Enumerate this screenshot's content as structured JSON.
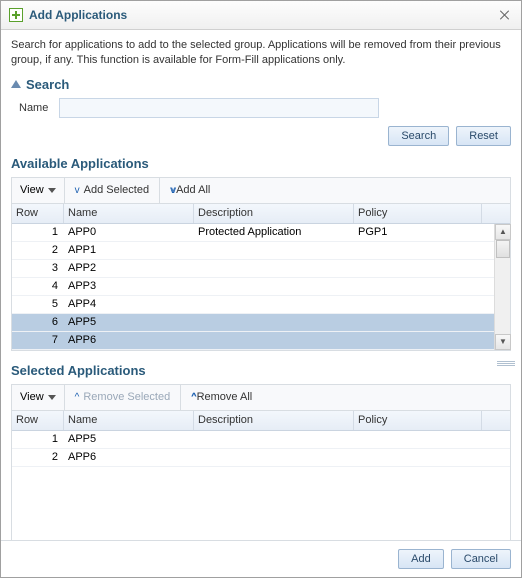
{
  "title": "Add Applications",
  "description": "Search for applications to add to the selected group. Applications will be removed from their previous group, if any. This function is available for Form-Fill applications only.",
  "search": {
    "heading": "Search",
    "name_label": "Name",
    "name_value": "",
    "search_btn": "Search",
    "reset_btn": "Reset"
  },
  "available": {
    "heading": "Available Applications",
    "view_label": "View",
    "add_selected": "Add Selected",
    "add_all": "Add All",
    "columns": {
      "row": "Row",
      "name": "Name",
      "desc": "Description",
      "policy": "Policy"
    },
    "rows": [
      {
        "n": "1",
        "name": "APP0",
        "desc": "Protected Application",
        "policy": "PGP1",
        "selected": false
      },
      {
        "n": "2",
        "name": "APP1",
        "desc": "",
        "policy": "",
        "selected": false
      },
      {
        "n": "3",
        "name": "APP2",
        "desc": "",
        "policy": "",
        "selected": false
      },
      {
        "n": "4",
        "name": "APP3",
        "desc": "",
        "policy": "",
        "selected": false
      },
      {
        "n": "5",
        "name": "APP4",
        "desc": "",
        "policy": "",
        "selected": false
      },
      {
        "n": "6",
        "name": "APP5",
        "desc": "",
        "policy": "",
        "selected": true
      },
      {
        "n": "7",
        "name": "APP6",
        "desc": "",
        "policy": "",
        "selected": true
      }
    ]
  },
  "selected": {
    "heading": "Selected Applications",
    "view_label": "View",
    "remove_selected": "Remove Selected",
    "remove_all": "Remove All",
    "columns": {
      "row": "Row",
      "name": "Name",
      "desc": "Description",
      "policy": "Policy"
    },
    "rows": [
      {
        "n": "1",
        "name": "APP5",
        "desc": "",
        "policy": ""
      },
      {
        "n": "2",
        "name": "APP6",
        "desc": "",
        "policy": ""
      }
    ]
  },
  "footer": {
    "add": "Add",
    "cancel": "Cancel"
  }
}
